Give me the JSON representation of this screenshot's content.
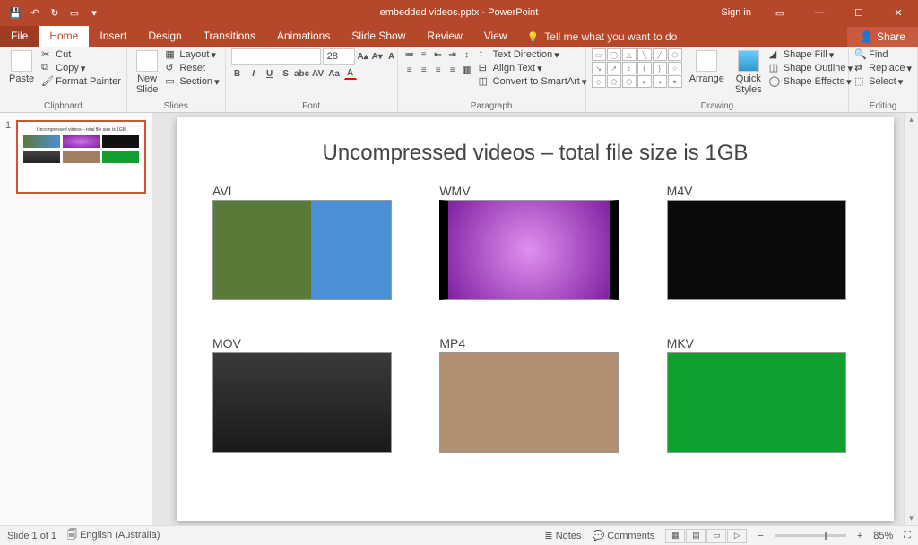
{
  "title": "embedded videos.pptx - PowerPoint",
  "signin": "Sign in",
  "tabs": {
    "file": "File",
    "home": "Home",
    "insert": "Insert",
    "design": "Design",
    "transitions": "Transitions",
    "animations": "Animations",
    "slideshow": "Slide Show",
    "review": "Review",
    "view": "View"
  },
  "tellme": "Tell me what you want to do",
  "share": "Share",
  "ribbon": {
    "clipboard": {
      "label": "Clipboard",
      "paste": "Paste",
      "cut": "Cut",
      "copy": "Copy",
      "painter": "Format Painter"
    },
    "slides": {
      "label": "Slides",
      "new": "New\nSlide",
      "layout": "Layout",
      "reset": "Reset",
      "section": "Section"
    },
    "font": {
      "label": "Font",
      "name": "",
      "size": "28"
    },
    "paragraph": {
      "label": "Paragraph",
      "dir": "Text Direction",
      "align": "Align Text",
      "smart": "Convert to SmartArt"
    },
    "drawing": {
      "label": "Drawing",
      "arrange": "Arrange",
      "quick": "Quick\nStyles",
      "fill": "Shape Fill",
      "outline": "Shape Outline",
      "effects": "Shape Effects"
    },
    "editing": {
      "label": "Editing",
      "find": "Find",
      "replace": "Replace",
      "select": "Select"
    }
  },
  "slide": {
    "title": "Uncompressed videos – total file size is 1GB",
    "videos": [
      {
        "label": "AVI"
      },
      {
        "label": "WMV"
      },
      {
        "label": "M4V"
      },
      {
        "label": "MOV"
      },
      {
        "label": "MP4"
      },
      {
        "label": "MKV"
      }
    ]
  },
  "thumb_colors": [
    "linear-gradient(90deg,#5a7a3a,#4a90d6)",
    "radial-gradient(#d070e0,#8020a0)",
    "#111",
    "linear-gradient(#444,#222)",
    "#a08060",
    "#10a030"
  ],
  "status": {
    "slide": "Slide 1 of 1",
    "lang": "English (Australia)",
    "notes": "Notes",
    "comments": "Comments",
    "zoom": "85%"
  }
}
